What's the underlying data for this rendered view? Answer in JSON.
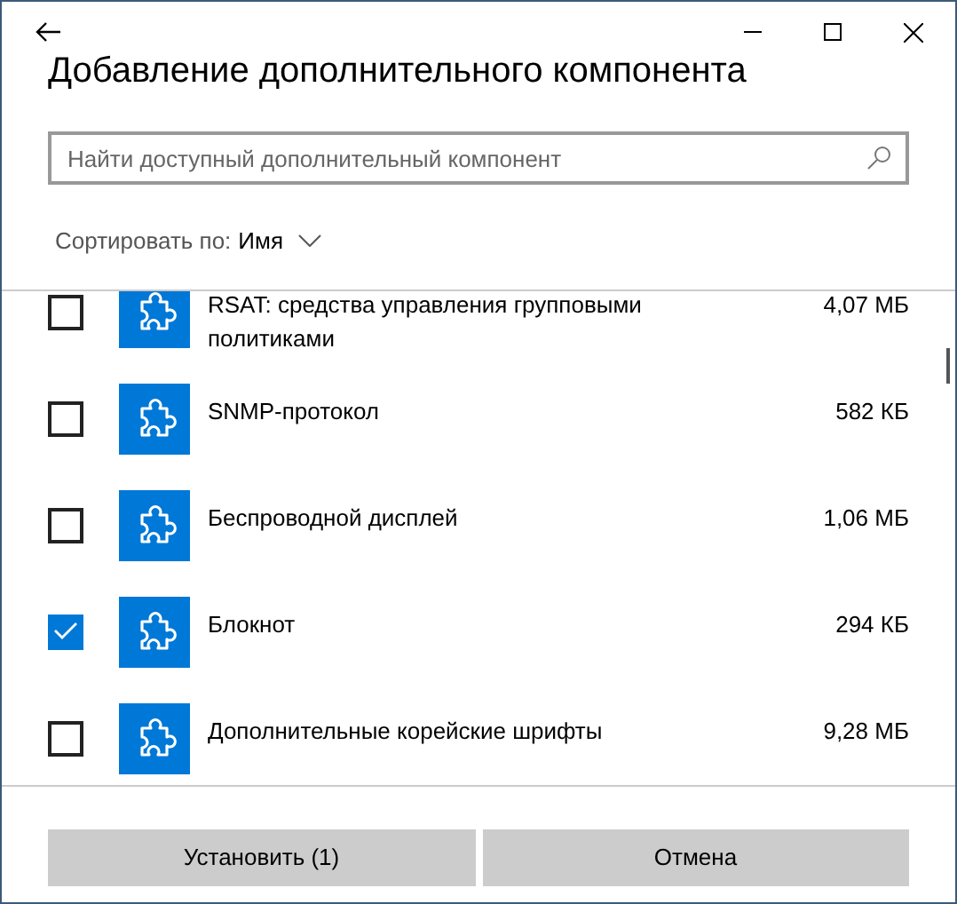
{
  "window": {
    "title": "Добавление дополнительного компонента"
  },
  "search": {
    "placeholder": "Найти доступный дополнительный компонент"
  },
  "sort": {
    "label": "Сортировать по:",
    "value": "Имя"
  },
  "features": [
    {
      "name": "RSAT: средства управления групповыми политиками",
      "size": "4,07 МБ",
      "checked": false
    },
    {
      "name": "SNMP-протокол",
      "size": "582 КБ",
      "checked": false
    },
    {
      "name": "Беспроводной дисплей",
      "size": "1,06 МБ",
      "checked": false
    },
    {
      "name": "Блокнот",
      "size": "294 КБ",
      "checked": true
    },
    {
      "name": "Дополнительные корейские шрифты",
      "size": "9,28 МБ",
      "checked": false
    }
  ],
  "buttons": [
    "Установить (1)",
    "Отмена"
  ]
}
